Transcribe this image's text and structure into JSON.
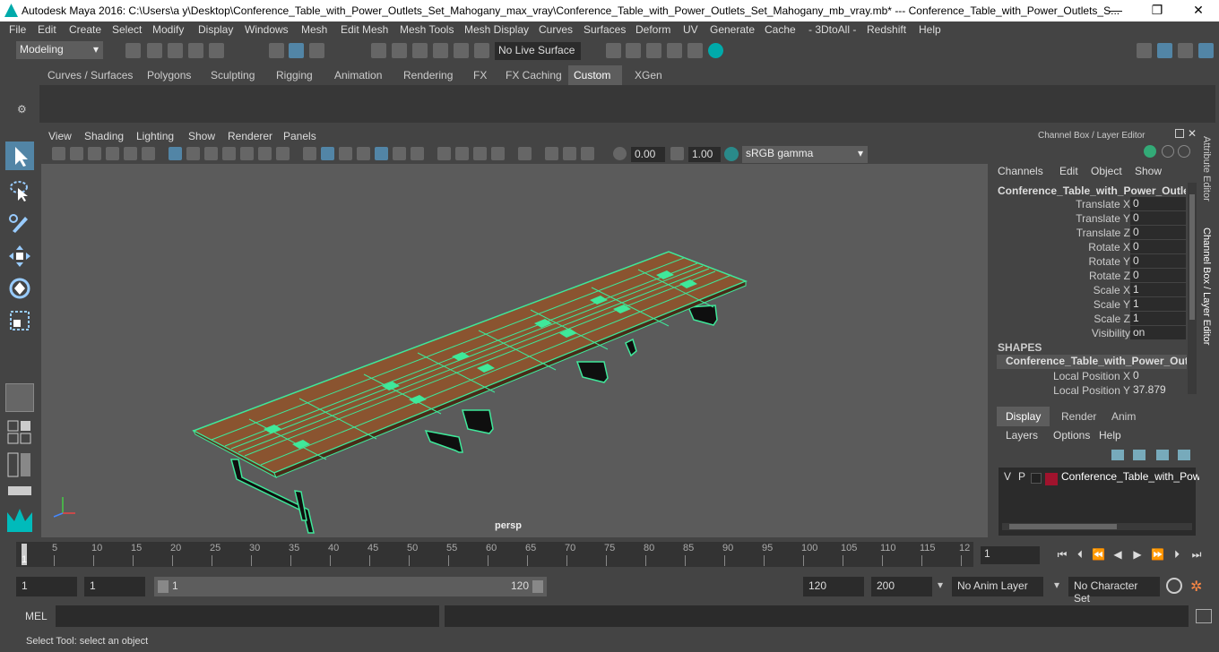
{
  "window": {
    "title": "Autodesk Maya 2016: C:\\Users\\a y\\Desktop\\Conference_Table_with_Power_Outlets_Set_Mahogany_max_vray\\Conference_Table_with_Power_Outlets_Set_Mahogany_mb_vray.mb*   ---   Conference_Table_with_Power_Outlets_S...",
    "minimize": "—",
    "maximize": "❐",
    "close": "✕"
  },
  "menubar": [
    "File",
    "Edit",
    "Create",
    "Select",
    "Modify",
    "Display",
    "Windows",
    "Mesh",
    "Edit Mesh",
    "Mesh Tools",
    "Mesh Display",
    "Curves",
    "Surfaces",
    "Deform",
    "UV",
    "Generate",
    "Cache",
    "- 3DtoAll -",
    "Redshift",
    "Help"
  ],
  "status": {
    "mode": "Modeling",
    "live_surface": "No Live Surface"
  },
  "shelf_tabs": [
    "Curves / Surfaces",
    "Polygons",
    "Sculpting",
    "Rigging",
    "Animation",
    "Rendering",
    "FX",
    "FX Caching",
    "Custom",
    "XGen"
  ],
  "shelf_active": "Custom",
  "viewport": {
    "menu": [
      "View",
      "Shading",
      "Lighting",
      "Show",
      "Renderer",
      "Panels"
    ],
    "exposure": "0.00",
    "gamma": "1.00",
    "color_space": "sRGB gamma",
    "camera": "persp"
  },
  "channel_box": {
    "title": "Channel Box / Layer Editor",
    "menu": [
      "Channels",
      "Edit",
      "Object",
      "Show"
    ],
    "object_name": "Conference_Table_with_Power_Outlet...",
    "attributes": [
      {
        "label": "Translate X",
        "value": "0"
      },
      {
        "label": "Translate Y",
        "value": "0"
      },
      {
        "label": "Translate Z",
        "value": "0"
      },
      {
        "label": "Rotate X",
        "value": "0"
      },
      {
        "label": "Rotate Y",
        "value": "0"
      },
      {
        "label": "Rotate Z",
        "value": "0"
      },
      {
        "label": "Scale X",
        "value": "1"
      },
      {
        "label": "Scale Y",
        "value": "1"
      },
      {
        "label": "Scale Z",
        "value": "1"
      },
      {
        "label": "Visibility",
        "value": "on"
      }
    ],
    "shapes_label": "SHAPES",
    "shape_name": "Conference_Table_with_Power_Outl...",
    "shape_attributes": [
      {
        "label": "Local Position X",
        "value": "0"
      },
      {
        "label": "Local Position Y",
        "value": "37.879"
      }
    ]
  },
  "layer_editor": {
    "tabs": [
      "Display",
      "Render",
      "Anim"
    ],
    "menu": [
      "Layers",
      "Options",
      "Help"
    ],
    "layer": {
      "v": "V",
      "p": "P",
      "name": "Conference_Table_with_Powe",
      "color": "#a0132d"
    }
  },
  "side_tabs": [
    "Attribute Editor",
    "Channel Box / Layer Editor"
  ],
  "timeline": {
    "ticks": [
      "5",
      "10",
      "15",
      "20",
      "25",
      "30",
      "35",
      "40",
      "45",
      "50",
      "55",
      "60",
      "65",
      "70",
      "75",
      "80",
      "85",
      "90",
      "95",
      "100",
      "105",
      "110",
      "115",
      "12"
    ],
    "current_frame_marker": "1",
    "current_frame": "1"
  },
  "range": {
    "start": "1",
    "playback_start": "1",
    "slider_start": "1",
    "slider_end": "120",
    "playback_end": "120",
    "end": "200",
    "anim_layer": "No Anim Layer",
    "character_set": "No Character Set"
  },
  "cmdline": {
    "label": "MEL"
  },
  "helpline": {
    "text": "Select Tool: select an object"
  }
}
